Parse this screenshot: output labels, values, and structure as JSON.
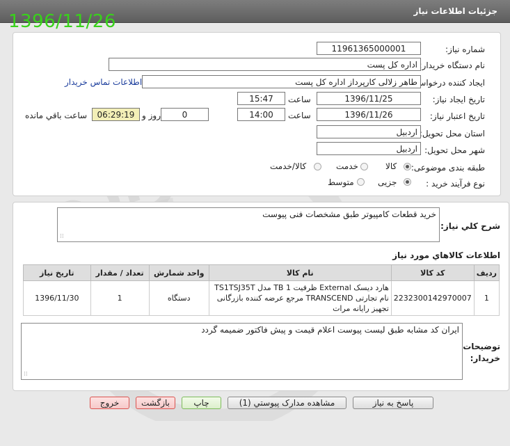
{
  "header": {
    "title": "جزئيات اطلاعات نياز"
  },
  "stamp_date": "1396/11/26",
  "form": {
    "need_number_label": "شماره نياز:",
    "need_number": "11961365000001",
    "buyer_org_label": "نام دستگاه خريدار:",
    "buyer_org": "اداره کل پست",
    "requester_label": "ايجاد کننده درخواست:",
    "requester": "طاهر زلالی کارپرداز اداره کل پست",
    "contact_link": "اطلاعات تماس خريدار",
    "created_label": "تاريخ ايجاد نياز:",
    "created_date": "1396/11/25",
    "time_label": "ساعت",
    "created_time": "15:47",
    "valid_label": "تاريخ اعتبار نياز:",
    "valid_date": "1396/11/26",
    "valid_time": "14:00",
    "days_value": "0",
    "days_label": "روز و",
    "remaining_time": "06:29:19",
    "remaining_label": "ساعت باقي مانده",
    "province_label": "استان محل تحويل:",
    "province": "اردبيل",
    "city_label": "شهر محل تحويل:",
    "city": "اردبيل",
    "category_label": "طبقه بندی موضوعی:",
    "category_options": [
      "کالا",
      "خدمت",
      "کالا/خدمت"
    ],
    "category_selected": "کالا",
    "process_label": "نوع فرآيند خريد :",
    "process_options": [
      "جزيی",
      "متوسط"
    ],
    "process_selected": "جزيی"
  },
  "summary": {
    "label": "شرح کلي نياز:",
    "text": "خريد قطعات کامپيوتر طبق مشخصات فنی پيوست"
  },
  "items": {
    "title": "اطلاعات کالاهاي مورد نياز",
    "columns": [
      "رديف",
      "کد کالا",
      "نام کالا",
      "واحد شمارش",
      "تعداد / مقدار",
      "تاريخ نياز"
    ],
    "rows": [
      {
        "row": "1",
        "code": "2232300142970007",
        "name": "هارد ديسک External ظرفيت TB 1 مدل TS1TSJ35T نام تجارتی TRANSCEND مرجع عرضه کننده بازرگانی تجهيز رايانه مرات",
        "unit": "دستگاه",
        "qty": "1",
        "date": "1396/11/30"
      }
    ]
  },
  "buyer_notes": {
    "label": "توضيحات خريدار:",
    "text": "ايران کد مشابه طبق ليست پيوست اعلام قيمت و پيش فاکتور ضميمه گردد"
  },
  "buttons": {
    "reply": "پاسخ به نياز",
    "attachments": "مشاهده مدارک پيوستي (1)",
    "print": "چاپ",
    "back": "بازگشت",
    "exit": "خروج"
  },
  "watermark": {
    "text": "هزاره",
    "subtext": "گستران ارتباط"
  },
  "colors": {
    "stamp": "#39d11b",
    "header": "#6b6b6b",
    "link": "#1a3c9c",
    "remaining_bg": "#f3efb7"
  }
}
